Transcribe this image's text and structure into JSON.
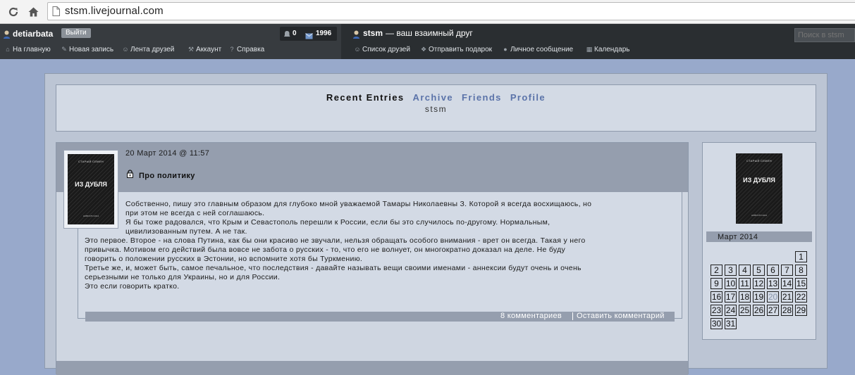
{
  "browser": {
    "url": "stsm.livejournal.com"
  },
  "ljbar": {
    "username": "detiarbata",
    "logout_label": "Выйти",
    "counter_notifications": "0",
    "counter_messages": "1996",
    "links_left": [
      "На главную",
      "Новая запись",
      "Лента друзей",
      "Аккаунт",
      "Справка"
    ],
    "journal_user": "stsm",
    "journal_tagline": "— ваш взаимный друг",
    "links_right": [
      "Список друзей",
      "Отправить подарок",
      "Личное сообщение",
      "Календарь"
    ],
    "search_placeholder": "Поиск в stsm"
  },
  "header": {
    "nav": [
      "Recent Entries",
      "Archive",
      "Friends",
      "Profile"
    ],
    "journal_name": "stsm"
  },
  "userpic": {
    "top_text": "СТАРЫЙ СЕМЕН",
    "title": "ИЗ ДУБЛЯ",
    "bottom_text": "НОВОСТИ 2014"
  },
  "entry": {
    "date": "20 Март 2014 @ 11:57",
    "subject": "Про политику",
    "lines": [
      "Собственно, пишу это главным образом для глубоко мной уважаемой Тамары Николаевны З. Которой я всегда восхищаюсь, но",
      "при этом не всегда с ней соглашаюсь.",
      "Я бы тоже радовался, что Крым и Севастополь перешли к России, если бы это случилось по-другому. Нормальным,",
      "цивилизованным путем. А не так.",
      "Это первое. Второе - на слова Путина, как бы они красиво не звучали, нельзя обращать особого внимания - врет он всегда. Такая у него",
      "привычка. Мотивом его действий была вовсе не забота о русских - то, что его не волнует, он многократно доказал на деле. Не буду",
      "говорить о положении русских в Эстонии, но вспомните хотя бы Туркмению.",
      "Третье же, и, может быть, самое печальное, что последствия - давайте называть вещи своими именами - аннексии будут очень и очень",
      "серьезными не только для Украины, но и для России.",
      "Это если говорить кратко."
    ],
    "comments_label": "8 комментариев",
    "leave_comment_label": "Оставить комментарий"
  },
  "calendar": {
    "title": "Март 2014",
    "today": "20",
    "weeks": [
      [
        "",
        "",
        "",
        "",
        "",
        "",
        "1"
      ],
      [
        "2",
        "3",
        "4",
        "5",
        "6",
        "7",
        "8"
      ],
      [
        "9",
        "10",
        "11",
        "12",
        "13",
        "14",
        "15"
      ],
      [
        "16",
        "17",
        "18",
        "19",
        "20",
        "21",
        "22"
      ],
      [
        "23",
        "24",
        "25",
        "26",
        "27",
        "28",
        "29"
      ],
      [
        "30",
        "31",
        "",
        "",
        "",
        "",
        ""
      ]
    ]
  }
}
